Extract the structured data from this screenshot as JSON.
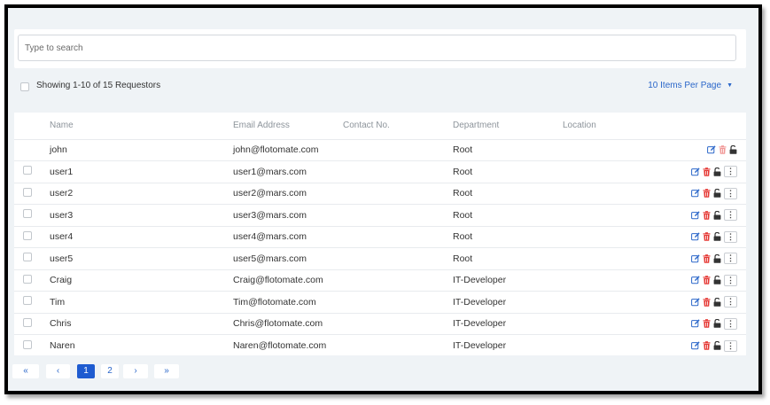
{
  "search": {
    "placeholder": "Type to search"
  },
  "toolbar": {
    "showing_text": "Showing 1-10 of 15 Requestors",
    "per_page_label": "10 Items Per Page"
  },
  "table": {
    "headers": [
      "Name",
      "Email Address",
      "Contact No.",
      "Department",
      "Location"
    ],
    "rows": [
      {
        "name": "john",
        "email": "john@flotomate.com",
        "contact": "",
        "department": "Root",
        "location": "",
        "has_checkbox": false
      },
      {
        "name": "user1",
        "email": "user1@mars.com",
        "contact": "",
        "department": "Root",
        "location": "",
        "has_checkbox": true
      },
      {
        "name": "user2",
        "email": "user2@mars.com",
        "contact": "",
        "department": "Root",
        "location": "",
        "has_checkbox": true
      },
      {
        "name": "user3",
        "email": "user3@mars.com",
        "contact": "",
        "department": "Root",
        "location": "",
        "has_checkbox": true
      },
      {
        "name": "user4",
        "email": "user4@mars.com",
        "contact": "",
        "department": "Root",
        "location": "",
        "has_checkbox": true
      },
      {
        "name": "user5",
        "email": "user5@mars.com",
        "contact": "",
        "department": "Root",
        "location": "",
        "has_checkbox": true
      },
      {
        "name": "Craig",
        "email": "Craig@flotomate.com",
        "contact": "",
        "department": "IT-Developer",
        "location": "",
        "has_checkbox": true
      },
      {
        "name": "Tim",
        "email": "Tim@flotomate.com",
        "contact": "",
        "department": "IT-Developer",
        "location": "",
        "has_checkbox": true
      },
      {
        "name": "Chris",
        "email": "Chris@flotomate.com",
        "contact": "",
        "department": "IT-Developer",
        "location": "",
        "has_checkbox": true
      },
      {
        "name": "Naren",
        "email": "Naren@flotomate.com",
        "contact": "",
        "department": "IT-Developer",
        "location": "",
        "has_checkbox": true
      }
    ],
    "row_actions": [
      "edit-icon",
      "delete-icon",
      "unlock-icon",
      "more-icon"
    ],
    "more_glyph": "⋮"
  },
  "pagination": {
    "first": "«",
    "prev": "‹",
    "pages": [
      "1",
      "2"
    ],
    "current": "1",
    "next": "›",
    "last": "»"
  },
  "colors": {
    "accent": "#1e5bd0",
    "link": "#2a66c9",
    "delete": "#e53935",
    "background": "#eff3f6"
  }
}
